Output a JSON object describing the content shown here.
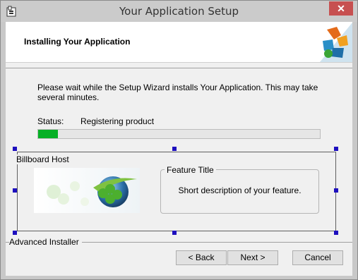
{
  "window": {
    "title": "Your Application Setup",
    "close_glyph": "✕"
  },
  "header": {
    "title": "Installing Your Application",
    "logo_icon": "installer-logo-icon"
  },
  "body": {
    "message": "Please wait while the Setup Wizard installs Your Application.  This may take several minutes.",
    "status_label": "Status:",
    "status_value": "Registering product",
    "progress_fraction": 0.07
  },
  "billboard": {
    "host_label": "Billboard Host",
    "feature_title": "Feature Title",
    "feature_description": "Short description of your feature."
  },
  "footer": {
    "brand": "Advanced Installer",
    "back_label": "< Back",
    "next_label": "Next >",
    "cancel_label": "Cancel"
  },
  "colors": {
    "progress": "#06b025",
    "handle": "#1d0fbe",
    "close": "#c75050"
  }
}
